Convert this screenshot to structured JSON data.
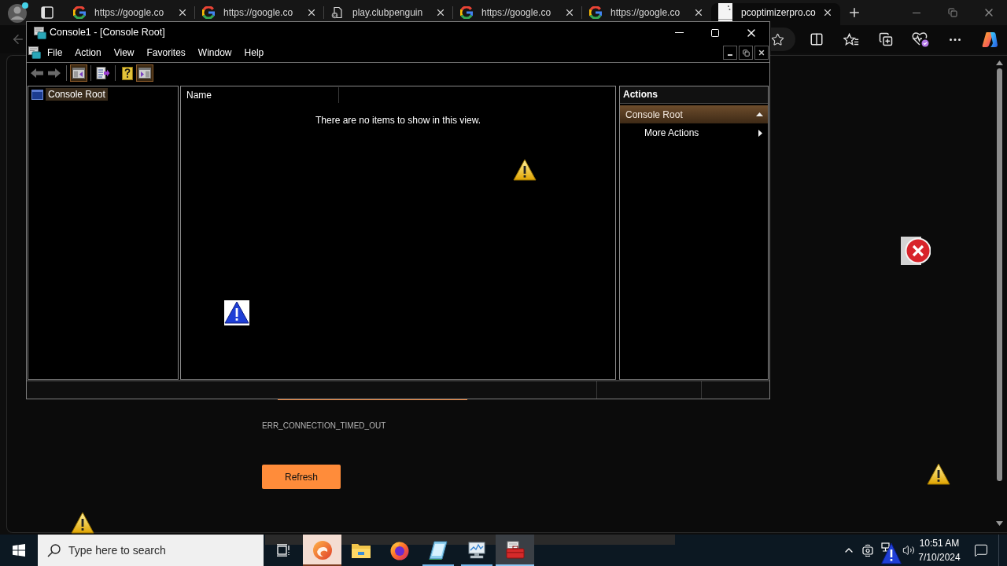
{
  "browser": {
    "tabs": [
      {
        "kind": "google",
        "label": "https://google.co",
        "selected": false
      },
      {
        "kind": "google",
        "label": "https://google.co",
        "selected": false
      },
      {
        "kind": "file",
        "label": "play.clubpenguin",
        "selected": false
      },
      {
        "kind": "google",
        "label": "https://google.co",
        "selected": false
      },
      {
        "kind": "google",
        "label": "https://google.co",
        "selected": false
      },
      {
        "kind": "page",
        "label": "pcoptimizerpro.co",
        "selected": true
      }
    ]
  },
  "page": {
    "error_code": "ERR_CONNECTION_TIMED_OUT",
    "button": "Refresh"
  },
  "console": {
    "title": "Console1 - [Console Root]",
    "menu": [
      "File",
      "Action",
      "View",
      "Favorites",
      "Window",
      "Help"
    ],
    "toolbar": [
      {
        "buttons": [
          {
            "kind": "back",
            "disabled": true,
            "pressed": false
          },
          {
            "kind": "forward",
            "disabled": true,
            "pressed": false
          }
        ]
      },
      {
        "buttons": [
          {
            "kind": "tree",
            "disabled": false,
            "pressed": true
          }
        ]
      },
      {
        "buttons": [
          {
            "kind": "export",
            "disabled": false,
            "pressed": false
          }
        ]
      },
      {
        "buttons": [
          {
            "kind": "help",
            "disabled": false,
            "pressed": false
          },
          {
            "kind": "action_pane",
            "disabled": false,
            "pressed": true
          }
        ]
      }
    ],
    "tree": [
      {
        "label": "Console Root",
        "selected": true
      }
    ],
    "list": {
      "columns": [
        "Name"
      ],
      "empty_message": "There are no items to show in this view."
    },
    "actions": {
      "title": "Actions",
      "sections": [
        {
          "label": "Console Root",
          "expanded": true,
          "items": [
            {
              "label": "More Actions",
              "submenu": true
            }
          ]
        }
      ]
    }
  },
  "taskbar": {
    "search": {
      "placeholder": "Type here to search"
    },
    "apps": [
      {
        "kind": "edge",
        "running": true,
        "selected": false,
        "flashing": true
      },
      {
        "kind": "explorer",
        "running": false,
        "selected": false,
        "flashing": false
      },
      {
        "kind": "firefox",
        "running": false,
        "selected": false,
        "flashing": false
      },
      {
        "kind": "notebook",
        "running": true,
        "selected": false,
        "flashing": false
      },
      {
        "kind": "monitor",
        "running": true,
        "selected": false,
        "flashing": false
      },
      {
        "kind": "toolbox",
        "running": true,
        "selected": true,
        "flashing": false
      }
    ],
    "clock": {
      "time": "10:51 AM",
      "date": "7/10/2024"
    }
  }
}
